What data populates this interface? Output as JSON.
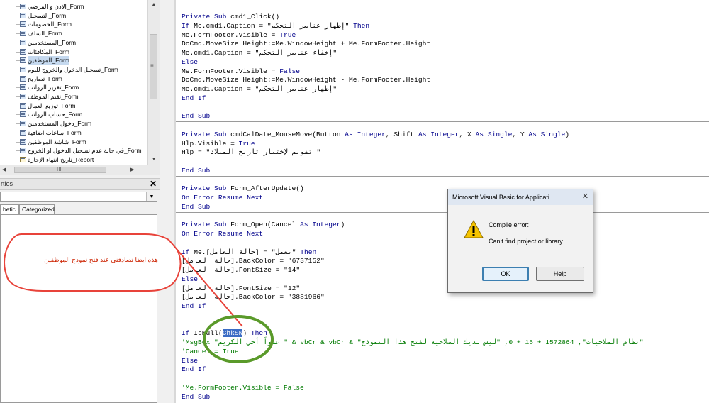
{
  "tree": {
    "items": [
      {
        "label": "الاذن و المرضي_Form",
        "icon": "form-icon"
      },
      {
        "label": "التسجيل_Form",
        "icon": "form-icon"
      },
      {
        "label": "الخصومات_Form",
        "icon": "form-icon"
      },
      {
        "label": "السلف_Form",
        "icon": "form-icon"
      },
      {
        "label": "المستخدمين_Form",
        "icon": "form-icon"
      },
      {
        "label": "المكافئات_Form",
        "icon": "form-icon"
      },
      {
        "label": "الموظفين_Form",
        "icon": "form-icon",
        "selected": true
      },
      {
        "label": "تسجيل الدخول والخروج لليوم_Form",
        "icon": "form-icon"
      },
      {
        "label": "تصاريح_Form",
        "icon": "form-icon"
      },
      {
        "label": "تقرير الرواتب_Form",
        "icon": "form-icon"
      },
      {
        "label": "تقيم الموظف_Form",
        "icon": "form-icon"
      },
      {
        "label": "توزيع العمال_Form",
        "icon": "form-icon"
      },
      {
        "label": "حساب الرواتب_Form",
        "icon": "form-icon"
      },
      {
        "label": "دخول المستخدمين_Form",
        "icon": "form-icon"
      },
      {
        "label": "ساعات اضافية_Form",
        "icon": "form-icon"
      },
      {
        "label": "شاشة الموظفين_Form",
        "icon": "form-icon"
      },
      {
        "label": "في حالة عدم تسجيل الدخول او الخروج_Form",
        "icon": "form-icon"
      },
      {
        "label": "تاريخ انتهاء الإجازة_Report",
        "icon": "report-icon"
      }
    ]
  },
  "properties": {
    "title": "rties",
    "close": "✕",
    "tabs": [
      "betic",
      "Categorized"
    ]
  },
  "code": {
    "lines": [
      [
        {
          "t": "Private Sub ",
          "c": "kw"
        },
        {
          "t": "cmd1_Click()"
        }
      ],
      [
        {
          "t": "If ",
          "c": "kw"
        },
        {
          "t": "Me.cmd1.Caption = \"إظهار عناصر التحكم\" "
        },
        {
          "t": "Then",
          "c": "kw"
        }
      ],
      [
        {
          "t": "Me.FormFooter.Visible = "
        },
        {
          "t": "True",
          "c": "kw"
        }
      ],
      [
        {
          "t": "DoCmd.MoveSize Height:=Me.WindowHeight + Me.FormFooter.Height"
        }
      ],
      [
        {
          "t": "Me.cmd1.Caption = \"إخفاء عناصر التحكم\""
        }
      ],
      [
        {
          "t": "Else",
          "c": "kw"
        }
      ],
      [
        {
          "t": "Me.FormFooter.Visible = "
        },
        {
          "t": "False",
          "c": "kw"
        }
      ],
      [
        {
          "t": "DoCmd.MoveSize Height:=Me.WindowHeight - Me.FormFooter.Height"
        }
      ],
      [
        {
          "t": "Me.cmd1.Caption = \"إظهار عناصر التحكم\""
        }
      ],
      [
        {
          "t": "End If",
          "c": "kw"
        }
      ],
      [],
      [
        {
          "t": "End Sub",
          "c": "kw"
        }
      ],
      [],
      [
        {
          "t": "Private Sub ",
          "c": "kw"
        },
        {
          "t": "cmdCalDate_MouseMove(Button "
        },
        {
          "t": "As Integer",
          "c": "kw"
        },
        {
          "t": ", Shift "
        },
        {
          "t": "As Integer",
          "c": "kw"
        },
        {
          "t": ", X "
        },
        {
          "t": "As Single",
          "c": "kw"
        },
        {
          "t": ", Y "
        },
        {
          "t": "As Single",
          "c": "kw"
        },
        {
          "t": ")"
        }
      ],
      [
        {
          "t": "Hlp.Visible = "
        },
        {
          "t": "True",
          "c": "kw"
        }
      ],
      [
        {
          "t": "Hlp = \"تقويم لإختيار تاريخ الميلاد \""
        }
      ],
      [],
      [
        {
          "t": "End Sub",
          "c": "kw"
        }
      ],
      [],
      [
        {
          "t": "Private Sub ",
          "c": "kw"
        },
        {
          "t": "Form_AfterUpdate()"
        }
      ],
      [
        {
          "t": "On Error Resume Next",
          "c": "kw"
        }
      ],
      [
        {
          "t": "End Sub",
          "c": "kw"
        }
      ],
      [],
      [
        {
          "t": "Private Sub ",
          "c": "kw"
        },
        {
          "t": "Form_Open(Cancel "
        },
        {
          "t": "As Integer",
          "c": "kw"
        },
        {
          "t": ")"
        }
      ],
      [
        {
          "t": "On Error Resume Next",
          "c": "kw"
        }
      ],
      [],
      [
        {
          "t": "If ",
          "c": "kw"
        },
        {
          "t": "Me.[حالة العامل] = \"يعمل\" "
        },
        {
          "t": "Then",
          "c": "kw"
        }
      ],
      [
        {
          "t": "[حالة العامل].BackColor = \"6737152\""
        }
      ],
      [
        {
          "t": "[حالة العامل].FontSize = \"14\""
        }
      ],
      [
        {
          "t": "Else",
          "c": "kw"
        }
      ],
      [
        {
          "t": "[حالة العامل].FontSize = \"12\""
        }
      ],
      [
        {
          "t": "[حالة العامل].BackColor = \"3881966\""
        }
      ],
      [
        {
          "t": "End If",
          "c": "kw"
        }
      ],
      [],
      [],
      [
        {
          "t": "If ",
          "c": "kw"
        },
        {
          "t": "IsNull("
        },
        {
          "t": "ChkSN",
          "c": "sel"
        },
        {
          "t": ") "
        },
        {
          "t": "Then",
          "c": "kw"
        }
      ],
      [
        {
          "t": "'MsgBox \"عفواً أخي الكريم \" & vbCr & vbCr & \"نظام الصلاحيات\", 1572864 + 16 + 0, \"ليس لديك الصلاحية لفتح هذا النموذج\"",
          "c": "cm"
        }
      ],
      [
        {
          "t": "'Cancel = True",
          "c": "cm"
        }
      ],
      [
        {
          "t": "Else",
          "c": "kw"
        }
      ],
      [
        {
          "t": "End If",
          "c": "kw"
        }
      ],
      [],
      [
        {
          "t": "'Me.FormFooter.Visible = False",
          "c": "cm"
        }
      ],
      [
        {
          "t": "End Sub",
          "c": "kw"
        }
      ]
    ]
  },
  "dialog": {
    "title": "Microsoft Visual Basic for Applicati...",
    "close": "✕",
    "message1": "Compile error:",
    "message2": "Can't find project or library",
    "ok_label": "OK",
    "help_label": "Help"
  },
  "annotation": {
    "text": "هذه ايضا تصادفني عند فتح نموذج الموظفين",
    "bubble_color": "#e8433a",
    "circle_color": "#5a9a2a"
  }
}
